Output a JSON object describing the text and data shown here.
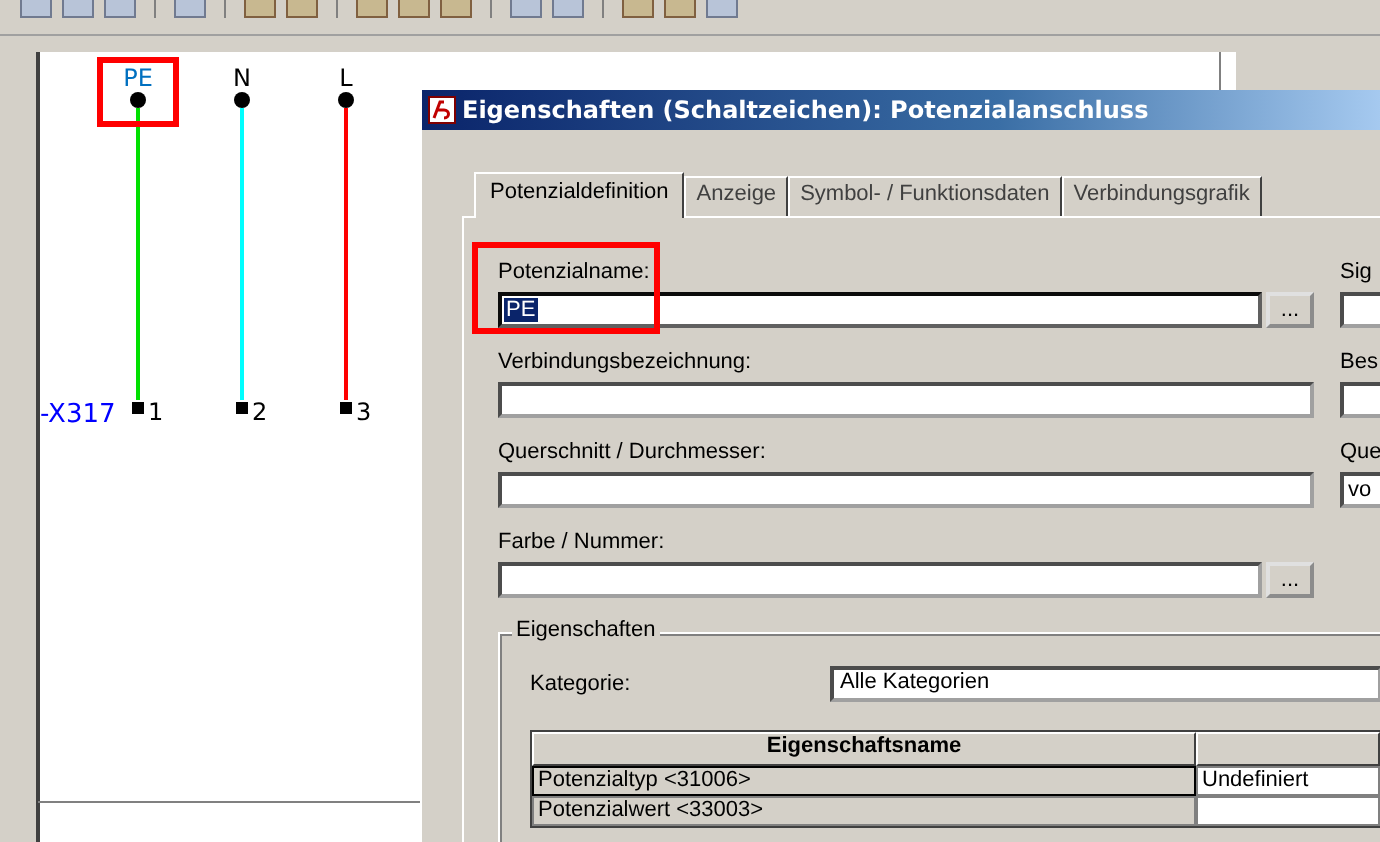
{
  "schematic": {
    "potentials": [
      {
        "label": "PE",
        "color": "#00e000",
        "highlighted": true,
        "terminal": "1"
      },
      {
        "label": "N",
        "color": "#00ffff",
        "highlighted": false,
        "terminal": "2"
      },
      {
        "label": "L",
        "color": "#ff0000",
        "highlighted": false,
        "terminal": "3"
      }
    ],
    "device_tag": "-X317"
  },
  "dialog": {
    "title": "Eigenschaften (Schaltzeichen): Potenzialanschluss",
    "tabs": [
      {
        "label": "Potenzialdefinition",
        "selected": true
      },
      {
        "label": "Anzeige",
        "selected": false
      },
      {
        "label": "Symbol- / Funktionsdaten",
        "selected": false
      },
      {
        "label": "Verbindungsgrafik",
        "selected": false
      }
    ],
    "fields": [
      {
        "label": "Potenzialname:",
        "value": "PE",
        "text_selected": true,
        "highlighted": true,
        "button": "...",
        "side_label": "Sig"
      },
      {
        "label": "Verbindungsbezeichnung:",
        "text_selected": false,
        "highlighted": false,
        "side_label": "Bes"
      },
      {
        "label": "Querschnitt / Durchmesser:",
        "text_selected": false,
        "highlighted": false,
        "side_label": "Que",
        "side_value": "vo"
      },
      {
        "label": "Farbe / Nummer:",
        "text_selected": false,
        "highlighted": false,
        "button": "..."
      }
    ],
    "group": {
      "title": "Eigenschaften",
      "category_label": "Kategorie:",
      "category_value": "Alle Kategorien",
      "table": {
        "columns": [
          "Eigenschaftsname"
        ],
        "rows": [
          {
            "name": "Potenzialtyp <31006>",
            "value": "Undefiniert"
          },
          {
            "name": "Potenzialwert <33003>"
          }
        ]
      }
    }
  }
}
